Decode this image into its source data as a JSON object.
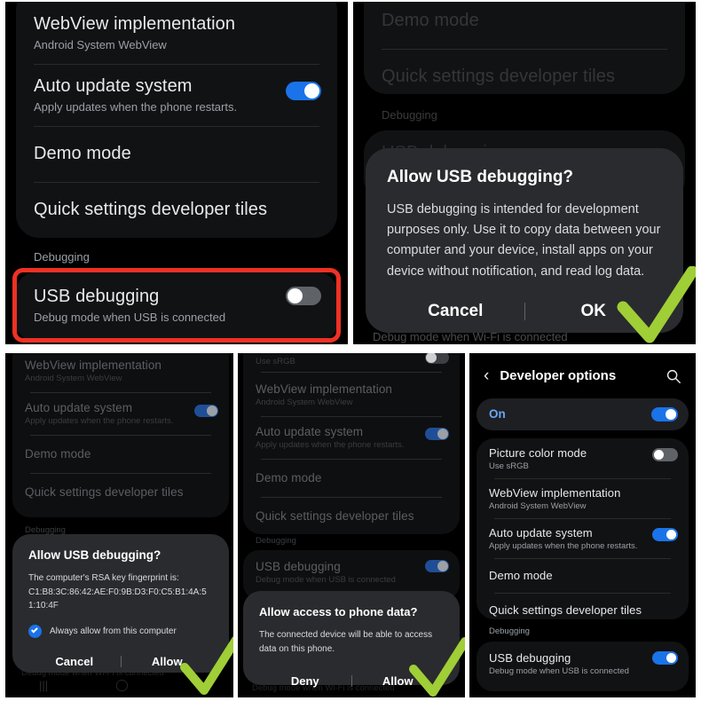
{
  "meta": {
    "accent_blue": "#1a73e8",
    "highlight_red": "#ee3124",
    "check_green": "#9fce37",
    "card_bg": "#111214",
    "dialog_bg": "#2a2b2e",
    "screen_bg": "#000000"
  },
  "panel1": {
    "name": "developer-options-usb-debugging-off",
    "rows": [
      {
        "title": "WebView implementation",
        "sub": "Android System WebView",
        "toggle": null
      },
      {
        "title": "Auto update system",
        "sub": "Apply updates when the phone restarts.",
        "toggle": "on"
      },
      {
        "title": "Demo mode",
        "sub": "",
        "toggle": null
      },
      {
        "title": "Quick settings developer tiles",
        "sub": "",
        "toggle": null
      }
    ],
    "section_label": "Debugging",
    "usb_row": {
      "title": "USB debugging",
      "sub": "Debug mode when USB is connected",
      "toggle": "off"
    }
  },
  "panel2": {
    "name": "allow-usb-debugging-dialog",
    "bg_rows": [
      {
        "title": "Demo mode",
        "sub": ""
      },
      {
        "title": "Quick settings developer tiles",
        "sub": ""
      }
    ],
    "section_label": "Debugging",
    "obscured_row": "USB debugging",
    "footer_text": "Debug mode when Wi-Fi is connected",
    "dialog": {
      "title": "Allow USB debugging?",
      "body": "USB debugging is intended for development purposes only. Use it to copy data between your computer and your device, install apps on your device without notification, and read log data.",
      "cancel": "Cancel",
      "confirm": "OK"
    }
  },
  "panel3": {
    "name": "allow-usb-debugging-rsa-dialog",
    "rows": [
      {
        "title": "WebView implementation",
        "sub": "Android System WebView",
        "toggle": null
      },
      {
        "title": "Auto update system",
        "sub": "Apply updates when the phone restarts.",
        "toggle": "on"
      },
      {
        "title": "Demo mode",
        "sub": "",
        "toggle": null
      },
      {
        "title": "Quick settings developer tiles",
        "sub": "",
        "toggle": null
      }
    ],
    "section_label": "Debugging",
    "footer_text": "Debug mode when Wi-Fi is connected",
    "dialog": {
      "title": "Allow USB debugging?",
      "body_line1": "The computer's RSA key fingerprint is:",
      "fingerprint": "C1:B8:3C:86:42:AE:F0:9B:D3:F0:C5:B1:4A:51:10:4F",
      "checkbox_label": "Always allow from this computer",
      "checkbox_checked": true,
      "cancel": "Cancel",
      "confirm": "Allow"
    }
  },
  "panel4": {
    "name": "allow-access-to-phone-data-dialog",
    "top_sub": "Use sRGB",
    "rows": [
      {
        "title": "WebView implementation",
        "sub": "Android System WebView",
        "toggle": null
      },
      {
        "title": "Auto update system",
        "sub": "Apply updates when the phone restarts.",
        "toggle": "on"
      },
      {
        "title": "Demo mode",
        "sub": "",
        "toggle": null
      },
      {
        "title": "Quick settings developer tiles",
        "sub": "",
        "toggle": null
      }
    ],
    "section_label": "Debugging",
    "usb_row": {
      "title": "USB debugging",
      "sub": "Debug mode when USB is connected",
      "toggle": "on"
    },
    "footer_text": "Debug mode when Wi-Fi is connected",
    "dialog": {
      "title": "Allow access to phone data?",
      "body": "The connected device will be able to access data on this phone.",
      "cancel": "Deny",
      "confirm": "Allow"
    }
  },
  "panel5": {
    "name": "developer-options-usb-debugging-on",
    "header": {
      "title": "Developer options",
      "back_icon": "chevron-left-icon",
      "search_icon": "search-icon"
    },
    "master": {
      "label": "On",
      "toggle": "on"
    },
    "rows": [
      {
        "title": "Picture color mode",
        "sub": "Use sRGB",
        "toggle": "off"
      },
      {
        "title": "WebView implementation",
        "sub": "Android System WebView",
        "toggle": null
      },
      {
        "title": "Auto update system",
        "sub": "Apply updates when the phone restarts.",
        "toggle": "on"
      },
      {
        "title": "Demo mode",
        "sub": "",
        "toggle": null
      },
      {
        "title": "Quick settings developer tiles",
        "sub": "",
        "toggle": null
      }
    ],
    "section_label": "Debugging",
    "usb_row": {
      "title": "USB debugging",
      "sub": "Debug mode when USB is connected",
      "toggle": "on"
    }
  }
}
